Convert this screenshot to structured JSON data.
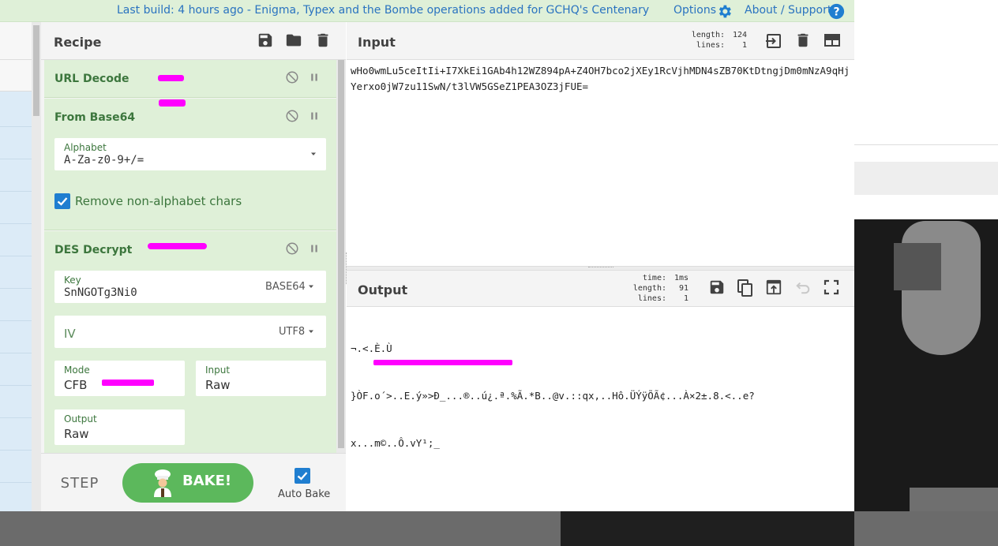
{
  "banner": {
    "build_text": "Last build: 4 hours ago - Enigma, Typex and the Bombe operations added for GCHQ's Centenary",
    "options_label": "Options",
    "about_label": "About / Support"
  },
  "recipe": {
    "title": "Recipe",
    "operations": [
      {
        "name": "URL Decode"
      },
      {
        "name": "From Base64",
        "alphabet_label": "Alphabet",
        "alphabet_value": "A-Za-z0-9+/=",
        "remove_label": "Remove non-alphabet chars",
        "remove_checked": true
      },
      {
        "name": "DES Decrypt",
        "key_label": "Key",
        "key_value": "SnNGOTg3Ni0",
        "key_encoding": "BASE64",
        "iv_label": "IV",
        "iv_encoding": "UTF8",
        "mode_label": "Mode",
        "mode_value": "CFB",
        "input_label": "Input",
        "input_value": "Raw",
        "output_label": "Output",
        "output_value": "Raw"
      }
    ]
  },
  "controls": {
    "step_label": "STEP",
    "bake_label": "BAKE!",
    "autobake_label": "Auto Bake",
    "autobake_checked": true
  },
  "input": {
    "title": "Input",
    "length_label": "length:",
    "length_value": "124",
    "lines_label": "lines:",
    "lines_value": "1",
    "text": "wHo0wmLu5ceItIi+I7XkEi1GAb4h12WZ894pA+Z4OH7bco2jXEy1RcVjhMDN4sZB70KtDtngjDm0mNzA9qHjYerxo0jW7zu11SwN/t3lVW5GSeZ1PEA3OZ3jFUE="
  },
  "output": {
    "title": "Output",
    "time_label": "time:",
    "time_value": "1ms",
    "length_label": "length:",
    "length_value": "91",
    "lines_label": "lines:",
    "lines_value": "1",
    "lines": [
      "¬.<.È.Ù",
      "}ÒF.o´>..E.ý»>Ð_...®..ú¿.ª.%Ã.*B..@v.::qx,..Hô.ÜÝÿÕÃ¢...À×2±.8.<..e?",
      "x...m©..Ô.vY¹;_"
    ]
  }
}
